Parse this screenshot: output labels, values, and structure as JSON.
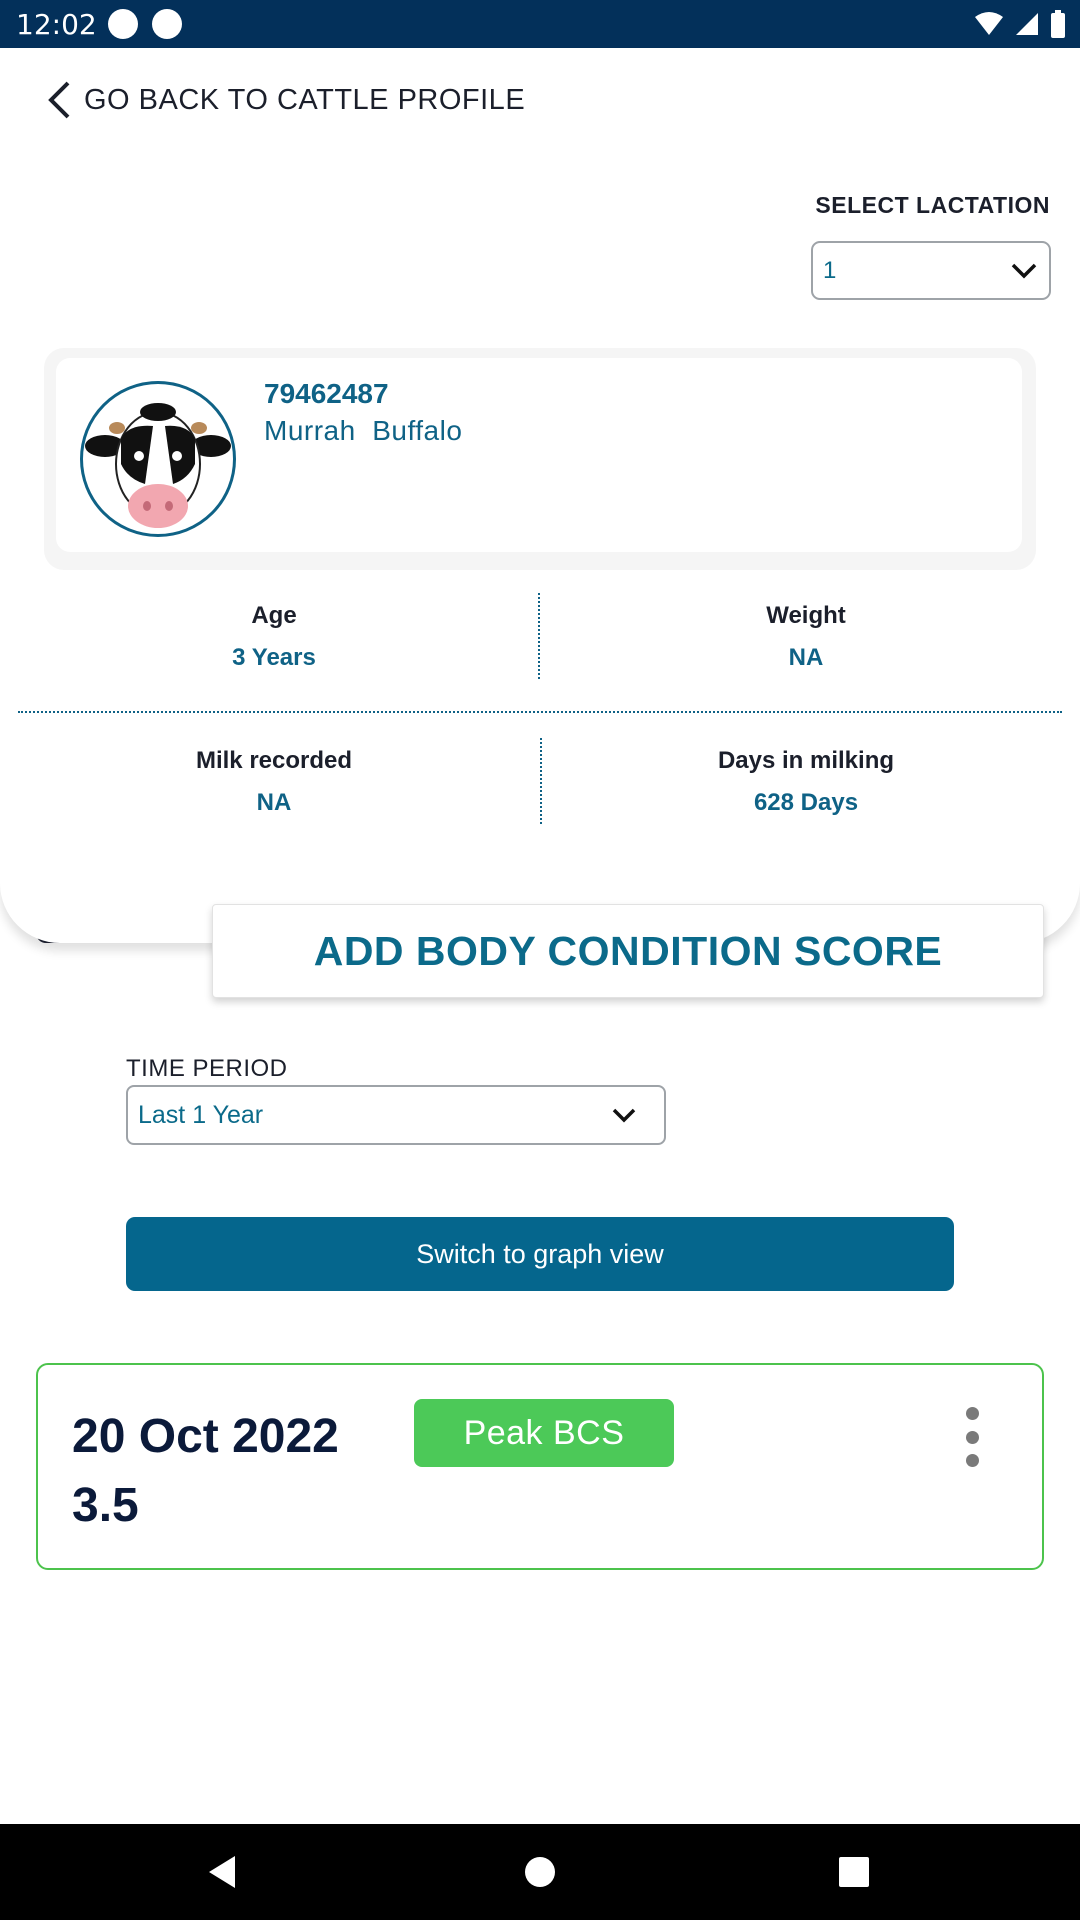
{
  "status_bar": {
    "time": "12:02"
  },
  "header": {
    "back_label": "GO BACK TO CATTLE PROFILE"
  },
  "lactation": {
    "label": "SELECT LACTATION",
    "value": "1"
  },
  "profile": {
    "id": "79462487",
    "breed": "Murrah  Buffalo"
  },
  "stats": {
    "age": {
      "label": "Age",
      "value": "3 Years"
    },
    "weight": {
      "label": "Weight",
      "value": "NA"
    },
    "milk": {
      "label": "Milk recorded",
      "value": "NA"
    },
    "days": {
      "label": "Days in milking",
      "value": "628 Days"
    }
  },
  "add_bcs": {
    "label": "ADD BODY CONDITION SCORE"
  },
  "time_period": {
    "label": "TIME PERIOD",
    "value": "Last 1 Year"
  },
  "graph_button": {
    "label": "Switch to graph view"
  },
  "records": [
    {
      "date": "20 Oct 2022",
      "score": "3.5",
      "badge": "Peak BCS"
    }
  ],
  "colors": {
    "status_bar": "#03305a",
    "accent": "#0b6a8a",
    "primary_button": "#05668d",
    "badge_green": "#4cc958",
    "card_border": "#4cc34c"
  }
}
